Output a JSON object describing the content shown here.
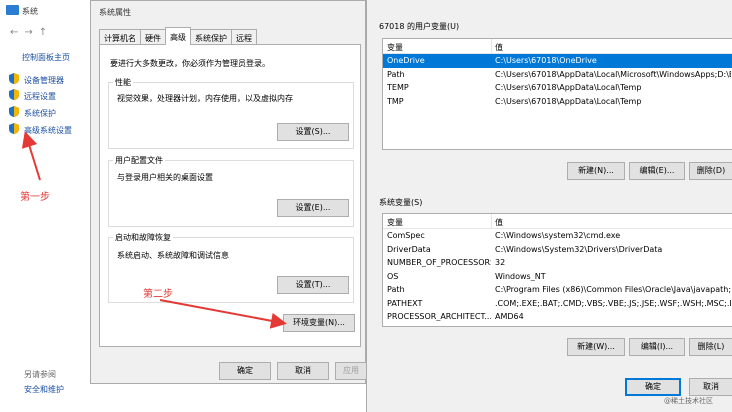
{
  "control_panel": {
    "title": "系统",
    "home": "控制面板主页",
    "links": [
      "设备管理器",
      "远程设置",
      "系统保护",
      "高级系统设置"
    ],
    "see_also": "另请参阅",
    "security": "安全和维护"
  },
  "system_properties": {
    "title": "系统属性",
    "tabs": [
      "计算机名",
      "硬件",
      "高级",
      "系统保护",
      "远程"
    ],
    "active_tab": "高级",
    "admin_note": "要进行大多数更改，你必须作为管理员登录。",
    "groups": [
      {
        "title": "性能",
        "desc": "视觉效果，处理器计划，内存使用，以及虚拟内存",
        "button": "设置(S)..."
      },
      {
        "title": "用户配置文件",
        "desc": "与登录用户相关的桌面设置",
        "button": "设置(E)..."
      },
      {
        "title": "启动和故障恢复",
        "desc": "系统启动、系统故障和调试信息",
        "button": "设置(T)..."
      }
    ],
    "env_button": "环境变量(N)...",
    "ok": "确定",
    "cancel": "取消",
    "apply": "应用"
  },
  "environment_variables": {
    "user_section": "67018 的用户变量(U)",
    "system_section": "系统变量(S)",
    "col_var": "变量",
    "col_val": "值",
    "user_vars": [
      {
        "name": "OneDrive",
        "value": "C:\\Users\\67018\\OneDrive"
      },
      {
        "name": "Path",
        "value": "C:\\Users\\67018\\AppData\\Local\\Microsoft\\WindowsApps;D:\\B..."
      },
      {
        "name": "TEMP",
        "value": "C:\\Users\\67018\\AppData\\Local\\Temp"
      },
      {
        "name": "TMP",
        "value": "C:\\Users\\67018\\AppData\\Local\\Temp"
      }
    ],
    "system_vars": [
      {
        "name": "ComSpec",
        "value": "C:\\Windows\\system32\\cmd.exe"
      },
      {
        "name": "DriverData",
        "value": "C:\\Windows\\System32\\Drivers\\DriverData"
      },
      {
        "name": "NUMBER_OF_PROCESSORS",
        "value": "32"
      },
      {
        "name": "OS",
        "value": "Windows_NT"
      },
      {
        "name": "Path",
        "value": "C:\\Program Files (x86)\\Common Files\\Oracle\\Java\\javapath;C:..."
      },
      {
        "name": "PATHEXT",
        "value": ".COM;.EXE;.BAT;.CMD;.VBS;.VBE;.JS;.JSE;.WSF;.WSH;.MSC;.PY;.P..."
      },
      {
        "name": "PROCESSOR_ARCHITECT...",
        "value": "AMD64"
      }
    ],
    "user_buttons": [
      "新建(N)...",
      "编辑(E)...",
      "删除(D)"
    ],
    "system_buttons": [
      "新建(W)...",
      "编辑(I)...",
      "删除(L)"
    ],
    "ok": "确定",
    "cancel": "取消"
  },
  "annotations": {
    "step1": "第一步",
    "step2": "第二步"
  },
  "watermark": "@稀土技术社区",
  "colors": {
    "selection": "#0078d7",
    "annotation": "#e53935",
    "link": "#1a4fa0"
  }
}
